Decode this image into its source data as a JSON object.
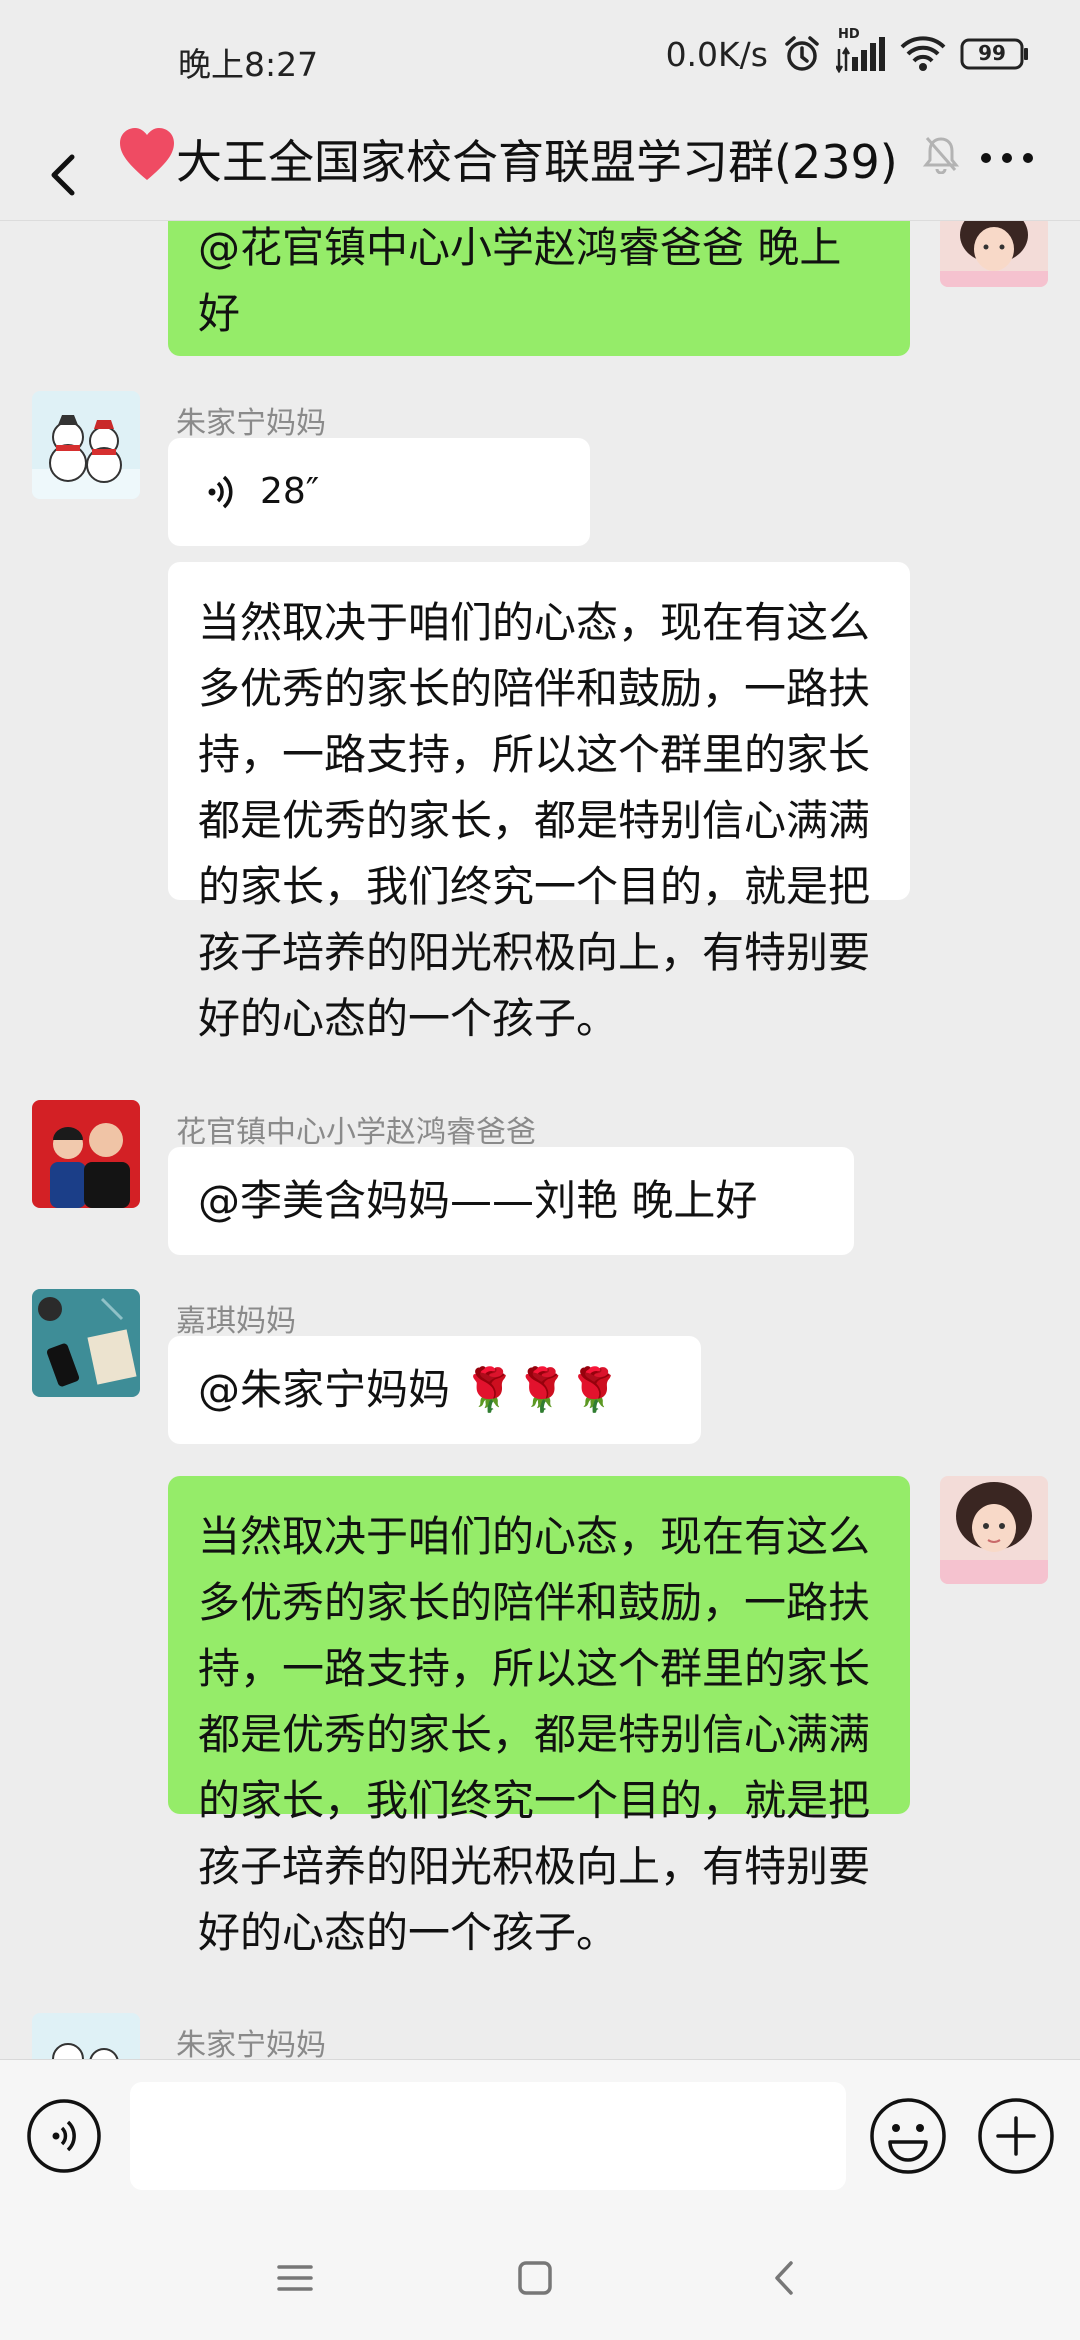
{
  "status_bar": {
    "time": "晚上8:27",
    "net_speed": "0.0K/s",
    "network_label": "HD",
    "battery": "99"
  },
  "header": {
    "back_icon": "chevron-left-icon",
    "emoji": "red-heart-icon",
    "title": "大王全国家校合育联盟学习群(239)",
    "mute_icon": "bell-off-icon",
    "more_icon": "more-icon"
  },
  "messages": [
    {
      "type": "text",
      "side": "right",
      "text": "@花官镇中心小学赵鸿睿爸爸  晚上好"
    },
    {
      "type": "voice",
      "side": "left",
      "sender": "朱家宁妈妈",
      "duration": "28″"
    },
    {
      "type": "text",
      "side": "left",
      "text": "当然取决于咱们的心态，现在有这么多优秀的家长的陪伴和鼓励，一路扶持，一路支持，所以这个群里的家长都是优秀的家长，都是特别信心满满的家长，我们终究一个目的，就是把孩子培养的阳光积极向上，有特别要好的心态的一个孩子。"
    },
    {
      "type": "text",
      "side": "left",
      "sender": "花官镇中心小学赵鸿睿爸爸",
      "text": "@李美含妈妈——刘艳  晚上好"
    },
    {
      "type": "text",
      "side": "left",
      "sender": "嘉琪妈妈",
      "text": "@朱家宁妈妈 🌹🌹🌹"
    },
    {
      "type": "text",
      "side": "right",
      "text": "当然取决于咱们的心态，现在有这么多优秀的家长的陪伴和鼓励，一路扶持，一路支持，所以这个群里的家长都是优秀的家长，都是特别信心满满的家长，我们终究一个目的，就是把孩子培养的阳光积极向上，有特别要好的心态的一个孩子。"
    },
    {
      "type": "partial",
      "side": "left",
      "sender": "朱家宁妈妈"
    }
  ],
  "input_bar": {
    "voice_icon": "voice-mode-icon",
    "text_value": "",
    "emoji_icon": "emoji-icon",
    "plus_icon": "plus-icon"
  },
  "nav_bar": {
    "menu_icon": "menu-icon",
    "home_icon": "home-icon",
    "back_icon": "back-icon"
  },
  "colors": {
    "background": "#ededed",
    "own_bubble": "#95ec69",
    "other_bubble": "#ffffff",
    "name_text": "#8a8a8a"
  }
}
